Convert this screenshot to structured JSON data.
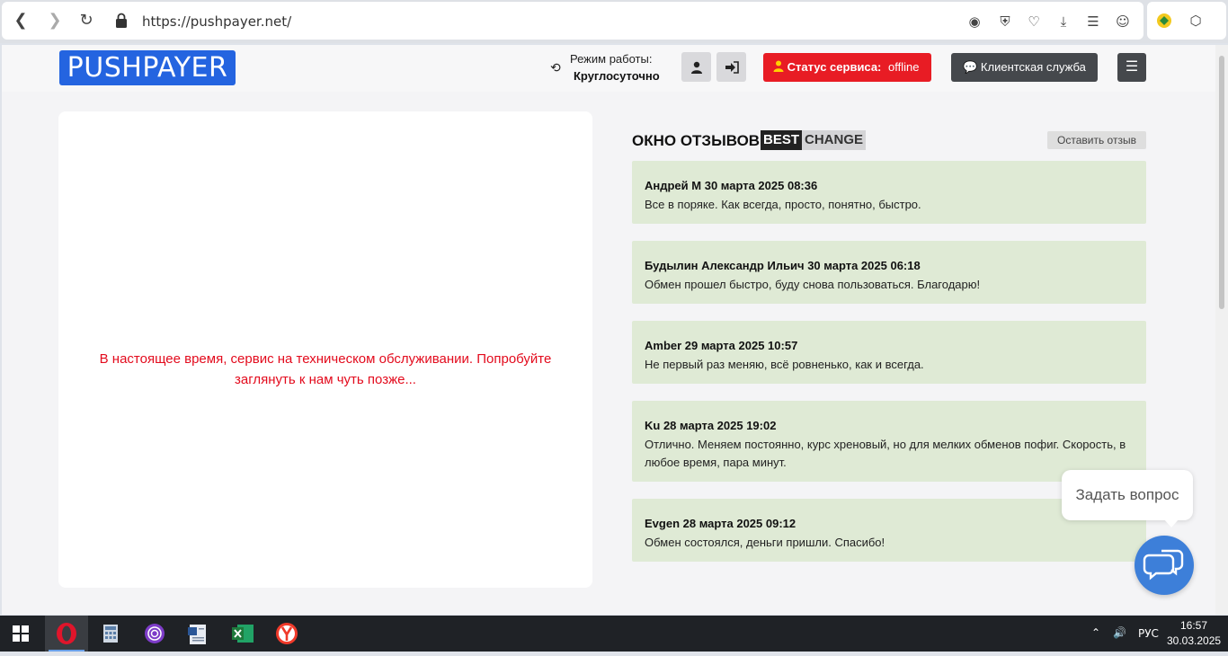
{
  "browser": {
    "url": "https://pushpayer.net/",
    "icons": [
      "back-icon",
      "forward-icon",
      "reload-icon",
      "lock-icon",
      "camera-icon",
      "shield-icon",
      "heart-icon",
      "download-icon",
      "settings-icon",
      "profile-icon",
      "extension-icon",
      "cube-icon"
    ]
  },
  "header": {
    "logo": "PUSHPAYER",
    "mode_label": "Режим работы:",
    "mode_value": "Круглосуточно",
    "status_label": "Статус сервиса:",
    "status_value": "offline",
    "support_label": "Клиентская служба"
  },
  "main": {
    "maintenance_line1": "В настоящее время, сервис на техническом обслуживании. Попробуйте",
    "maintenance_line2": "заглянуть к нам чуть позже..."
  },
  "reviews": {
    "title": "ОКНО ОТЗЫВОВ",
    "bc_best": "BEST",
    "bc_change": "CHANGE",
    "leave_label": "Оставить отзыв",
    "items": [
      {
        "author": "Андрей М 30 марта 2025 08:36",
        "text": "Все в поряке. Как всегда, просто, понятно, быстро."
      },
      {
        "author": "Будылин Александр Ильич 30 марта 2025 06:18",
        "text": "Обмен прошел быстро, буду снова пользоваться. Благодарю!"
      },
      {
        "author": "Amber 29 марта 2025 10:57",
        "text": "Не первый раз меняю, всё ровненько, как и всегда."
      },
      {
        "author": "Ku 28 марта 2025 19:02",
        "text": "Отлично. Меняем постоянно, курс хреновый, но для мелких обменов пофиг. Скорость, в любое время, пара минут."
      },
      {
        "author": "Evgen 28 марта 2025 09:12",
        "text": "Обмен состоялся, деньги пришли. Спасибо!"
      }
    ]
  },
  "chat": {
    "ask_label": "Задать вопрос"
  },
  "taskbar": {
    "lang": "РУС",
    "time": "16:57",
    "date": "30.03.2025",
    "colors": {
      "opera": "#e0152b",
      "excel": "#1e7a3c",
      "yandex": "#f03a2a",
      "tor": "#7d3cc8"
    }
  }
}
